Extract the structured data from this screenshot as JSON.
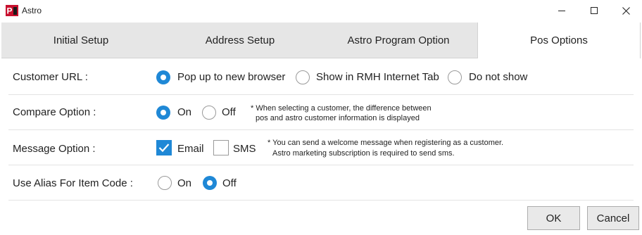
{
  "window": {
    "title": "Astro",
    "icon": "astro-pos-logo-icon",
    "controls": [
      "minimize-icon",
      "maximize-icon",
      "close-icon"
    ]
  },
  "tabs": [
    {
      "label": "Initial Setup",
      "active": false
    },
    {
      "label": "Address Setup",
      "active": false
    },
    {
      "label": "Astro Program Option",
      "active": false
    },
    {
      "label": "Pos Options",
      "active": true
    }
  ],
  "options": {
    "customer_url": {
      "label": "Customer URL :",
      "choices": [
        "Pop up to new browser",
        "Show in RMH Internet Tab",
        "Do not show"
      ],
      "selected": "Pop up to new browser"
    },
    "compare": {
      "label": "Compare Option :",
      "choices": [
        "On",
        "Off"
      ],
      "selected": "On",
      "note_line1": "* When selecting a customer, the difference between",
      "note_line2": "pos and astro customer information is displayed"
    },
    "message": {
      "label": "Message Option :",
      "email_label": "Email",
      "email_checked": true,
      "sms_label": "SMS",
      "sms_checked": false,
      "note_line1": "* You can send a welcome message when registering as a customer.",
      "note_line2": "Astro marketing subscription is required to send sms."
    },
    "alias": {
      "label": "Use Alias For Item Code :",
      "choices": [
        "On",
        "Off"
      ],
      "selected": "Off"
    }
  },
  "footer": {
    "ok_label": "OK",
    "cancel_label": "Cancel"
  },
  "colors": {
    "accent": "#1f88d6",
    "tab_bar": "#e6e6e6",
    "button_bg": "#e9e9e9"
  }
}
